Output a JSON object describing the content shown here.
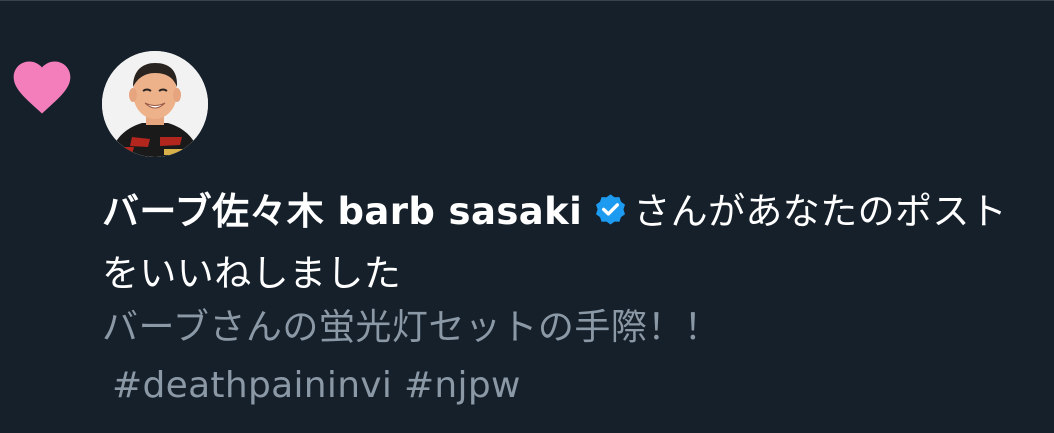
{
  "notification": {
    "type_icon": "heart-icon",
    "type_icon_color": "#f47ebb",
    "user": {
      "display_name": "バーブ佐々木 barb sasaki",
      "verified_icon": "verified-badge-icon",
      "verified_color": "#1d9bf0"
    },
    "action_text": "さんがあなたのポストをいいねしました",
    "tweet_text": "バーブさんの蛍光灯セットの手際！！",
    "hashtags_text": "#deathpaininvi #njpw"
  },
  "colors": {
    "background": "#15202b",
    "primary_text": "#ffffff",
    "secondary_text": "#8b98a5",
    "divider": "#38444d"
  }
}
